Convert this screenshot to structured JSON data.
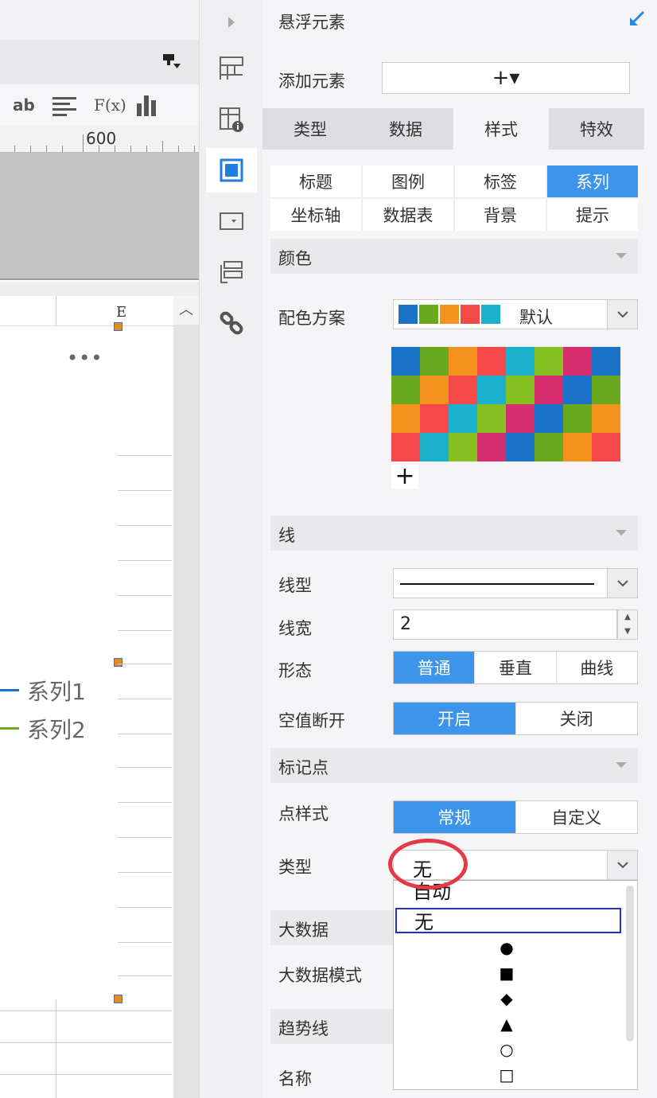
{
  "left": {
    "toolbar": {
      "text_style": "ab",
      "formula": "F(x)"
    },
    "ruler_label": "600",
    "column_header": "E",
    "more_label": "•••",
    "legend": [
      {
        "label": "系列1",
        "color": "#1a73c8"
      },
      {
        "label": "系列2",
        "color": "#6aa81e"
      }
    ]
  },
  "iconbar": {
    "icons": [
      "expand-arrow-icon",
      "grid-layout-icon",
      "table-info-icon",
      "chart-frame-icon",
      "dropdown-widget-icon",
      "label-widget-icon",
      "link-icon"
    ],
    "active": "chart-frame-icon"
  },
  "panel": {
    "title": "悬浮元素",
    "add_element_label": "添加元素",
    "add_button": "+▾",
    "tabs": [
      {
        "label": "类型",
        "selected": false
      },
      {
        "label": "数据",
        "selected": false
      },
      {
        "label": "样式",
        "selected": true
      },
      {
        "label": "特效",
        "selected": false
      }
    ],
    "subtabs": [
      {
        "label": "标题",
        "selected": false
      },
      {
        "label": "图例",
        "selected": false
      },
      {
        "label": "标签",
        "selected": false
      },
      {
        "label": "系列",
        "selected": true
      },
      {
        "label": "坐标轴",
        "selected": false
      },
      {
        "label": "数据表",
        "selected": false
      },
      {
        "label": "背景",
        "selected": false
      },
      {
        "label": "提示",
        "selected": false
      }
    ],
    "color_section": "颜色",
    "color_scheme_label": "配色方案",
    "color_scheme_value": "默认",
    "scheme_swatches": [
      "#1a73c8",
      "#6aa81e",
      "#f6921e",
      "#f54848",
      "#1bb0ce"
    ],
    "palette": [
      "#1a73c8",
      "#6aa81e",
      "#f6921e",
      "#f54848",
      "#1bb0ce",
      "#86c020",
      "#d42e6e",
      "#1a73c8",
      "#6aa81e",
      "#f6921e",
      "#f54848",
      "#1bb0ce",
      "#86c020",
      "#d42e6e",
      "#1a73c8",
      "#6aa81e",
      "#f6921e",
      "#f54848",
      "#1bb0ce",
      "#86c020",
      "#d42e6e",
      "#1a73c8",
      "#6aa81e",
      "#f6921e",
      "#f54848",
      "#1bb0ce",
      "#86c020",
      "#d42e6e",
      "#1a73c8",
      "#6aa81e",
      "#f6921e",
      "#f54848"
    ],
    "add_color": "+",
    "line_section": "线",
    "line_type_label": "线型",
    "line_width_label": "线宽",
    "line_width_value": "2",
    "shape_label": "形态",
    "shape_options": [
      {
        "label": "普通",
        "selected": true
      },
      {
        "label": "垂直",
        "selected": false
      },
      {
        "label": "曲线",
        "selected": false
      }
    ],
    "null_break_label": "空值断开",
    "null_break_options": [
      {
        "label": "开启",
        "selected": true
      },
      {
        "label": "关闭",
        "selected": false
      }
    ],
    "marker_section": "标记点",
    "point_style_label": "点样式",
    "point_style_options": [
      {
        "label": "常规",
        "selected": true
      },
      {
        "label": "自定义",
        "selected": false
      }
    ],
    "type_label": "类型",
    "type_value": "无",
    "type_options": [
      "自动",
      "无"
    ],
    "type_symbols": [
      "●",
      "■",
      "◆",
      "▲",
      "○",
      "□"
    ],
    "bigdata_section": "大数据",
    "bigdata_mode_label": "大数据模式",
    "trend_section": "趋势线",
    "name_label": "名称",
    "accent_color": "#3c95ea",
    "highlight_color": "#e63946"
  }
}
